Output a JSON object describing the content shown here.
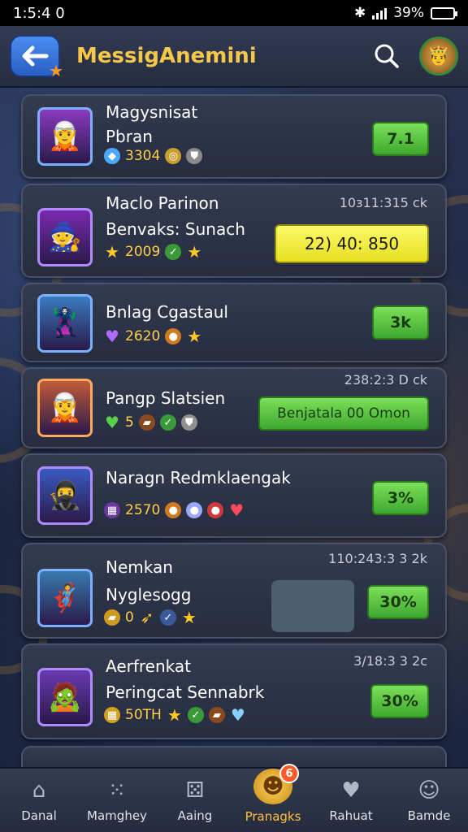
{
  "status": {
    "time": "1:5:4 0",
    "battery": "39%",
    "battery_fraction": 0.39
  },
  "header": {
    "title": "MessigAnemini"
  },
  "items": [
    {
      "name": "Magysnisat",
      "sub": "Pbran",
      "stat": "3304",
      "action": "7.1",
      "action_style": "green",
      "icons": [
        "blue-diamond",
        "gold-coin",
        "shield"
      ],
      "portrait": "🧝"
    },
    {
      "name": "Maclo Parinon",
      "sub": "Benvaks: Sunach",
      "time": "10з11:315 ck",
      "stat": "2009",
      "action": "22) 40: 850",
      "action_style": "yellow",
      "icons": [
        "gold-star",
        "green-check",
        "gold-star"
      ],
      "portrait": "🧙"
    },
    {
      "name": "Bnlag Cgastaul",
      "sub": "",
      "stat": "2620",
      "action": "3k",
      "action_style": "green",
      "icons": [
        "purple-heart",
        "orange-coin",
        "gold-star"
      ],
      "portrait": "🦹"
    },
    {
      "name": "Pangp Slatsien",
      "sub": "",
      "time": "238:2:3 D ck",
      "stat": "5",
      "action": "Benjatala 00 Omon",
      "action_style": "green-wide",
      "icons": [
        "green-heart",
        "brown-chest",
        "green-check",
        "grey-shield"
      ],
      "portrait": "🧝"
    },
    {
      "name": "Naragn Redmklaengak",
      "sub": "",
      "stat": "2570",
      "action": "3%",
      "action_style": "green",
      "icons": [
        "purple-box",
        "orange-coin",
        "blue-orb",
        "red-orb",
        "red-heart"
      ],
      "portrait": "🥷"
    },
    {
      "name": "Nemkan",
      "sub": "Nyglesogg",
      "time": "110:243:3 3 2k",
      "stat": "0",
      "action": "30%",
      "action_style": "green",
      "icons": [
        "gold-chest",
        "gold-wing",
        "blue-check",
        "gold-star"
      ],
      "portrait": "🦸"
    },
    {
      "name": "Aerfrenkat",
      "sub": "Peringcat Sennabrk",
      "time": "3/18:3 3 2c",
      "stat": "50TH",
      "action": "30%",
      "action_style": "green",
      "icons": [
        "gold-box",
        "gold-star",
        "green-check",
        "brown-chest",
        "blue-heart"
      ],
      "portrait": "🧟"
    }
  ],
  "nav": [
    {
      "label": "Danal",
      "icon": "home-icon",
      "glyph": "⌂"
    },
    {
      "label": "Mamghey",
      "icon": "dots-icon",
      "glyph": "⁙"
    },
    {
      "label": "Aaing",
      "icon": "dice-icon",
      "glyph": "⚄"
    },
    {
      "label": "Pranagks",
      "icon": "coin-icon",
      "glyph": "☻",
      "badge": "6",
      "active": true
    },
    {
      "label": "Rahuat",
      "icon": "heart-badge-icon",
      "glyph": "♥"
    },
    {
      "label": "Bamde",
      "icon": "profile-icon",
      "glyph": "☺"
    }
  ]
}
